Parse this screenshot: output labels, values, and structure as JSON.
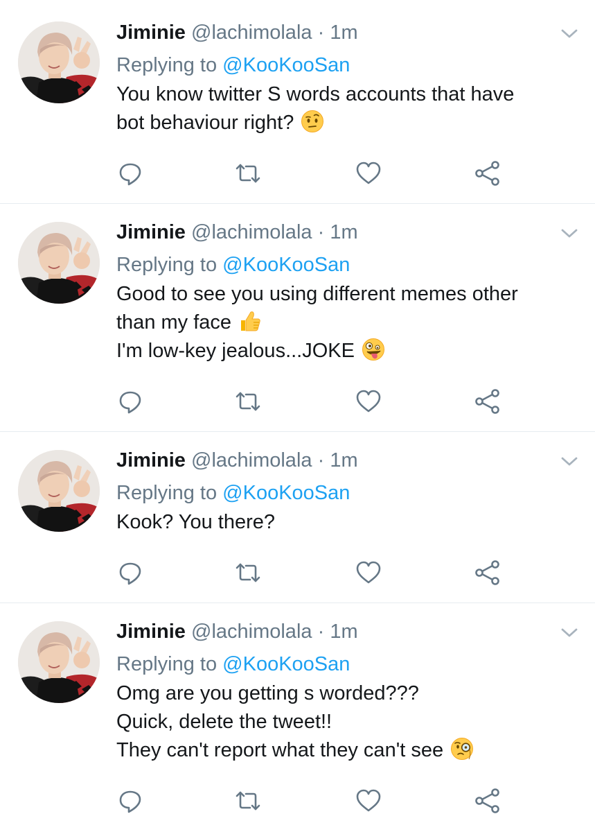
{
  "colors": {
    "text": "#14171a",
    "secondary": "#657786",
    "link": "#1da1f2",
    "divider": "#e6ecf0",
    "icon": "#657786"
  },
  "icons": {
    "reply": "reply-icon",
    "retweet": "retweet-icon",
    "like": "heart-icon",
    "share": "share-icon",
    "more": "chevron-down-icon"
  },
  "tweets": [
    {
      "display_name": "Jiminie",
      "handle": "@lachimolala",
      "separator": "·",
      "time": "1m",
      "replying_prefix": "Replying to",
      "replying_handle": "@KooKooSan",
      "lines": [
        "You know twitter S words accounts that have",
        "bot behaviour right?"
      ],
      "emoji": "face-with-raised-eyebrow"
    },
    {
      "display_name": "Jiminie",
      "handle": "@lachimolala",
      "separator": "·",
      "time": "1m",
      "replying_prefix": "Replying to",
      "replying_handle": "@KooKooSan",
      "lines": [
        "Good to see you using different memes other",
        "than my face",
        "I'm low-key jealous...JOKE"
      ],
      "emoji_line2": "thumbs-up",
      "emoji": "zany-face"
    },
    {
      "display_name": "Jiminie",
      "handle": "@lachimolala",
      "separator": "·",
      "time": "1m",
      "replying_prefix": "Replying to",
      "replying_handle": "@KooKooSan",
      "lines": [
        "Kook? You there?"
      ]
    },
    {
      "display_name": "Jiminie",
      "handle": "@lachimolala",
      "separator": "·",
      "time": "1m",
      "replying_prefix": "Replying to",
      "replying_handle": "@KooKooSan",
      "lines": [
        "Omg are you getting s worded???",
        "Quick, delete the tweet!!",
        "They can't report what they can't see"
      ],
      "emoji": "face-with-monocle"
    }
  ]
}
